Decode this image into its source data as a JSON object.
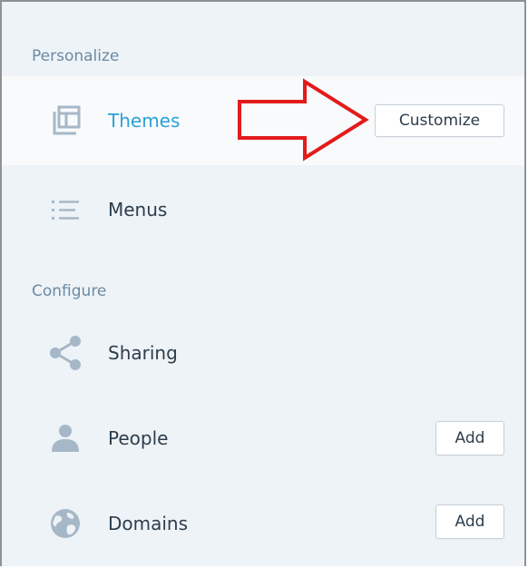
{
  "colors": {
    "accent": "#2ba1d6",
    "section_label": "#6b8aa3",
    "text": "#2d3d4c",
    "icon": "#a6b8c7",
    "arrow": "#e21b1b",
    "panel_bg": "#eef3f7"
  },
  "personalize": {
    "heading": "Personalize",
    "items": [
      {
        "label": "Themes",
        "icon": "themes-icon",
        "active": true,
        "button": "Customize"
      },
      {
        "label": "Menus",
        "icon": "menus-icon",
        "active": false
      }
    ]
  },
  "configure": {
    "heading": "Configure",
    "items": [
      {
        "label": "Sharing",
        "icon": "share-icon"
      },
      {
        "label": "People",
        "icon": "person-icon",
        "button": "Add"
      },
      {
        "label": "Domains",
        "icon": "globe-icon",
        "button": "Add"
      }
    ]
  }
}
